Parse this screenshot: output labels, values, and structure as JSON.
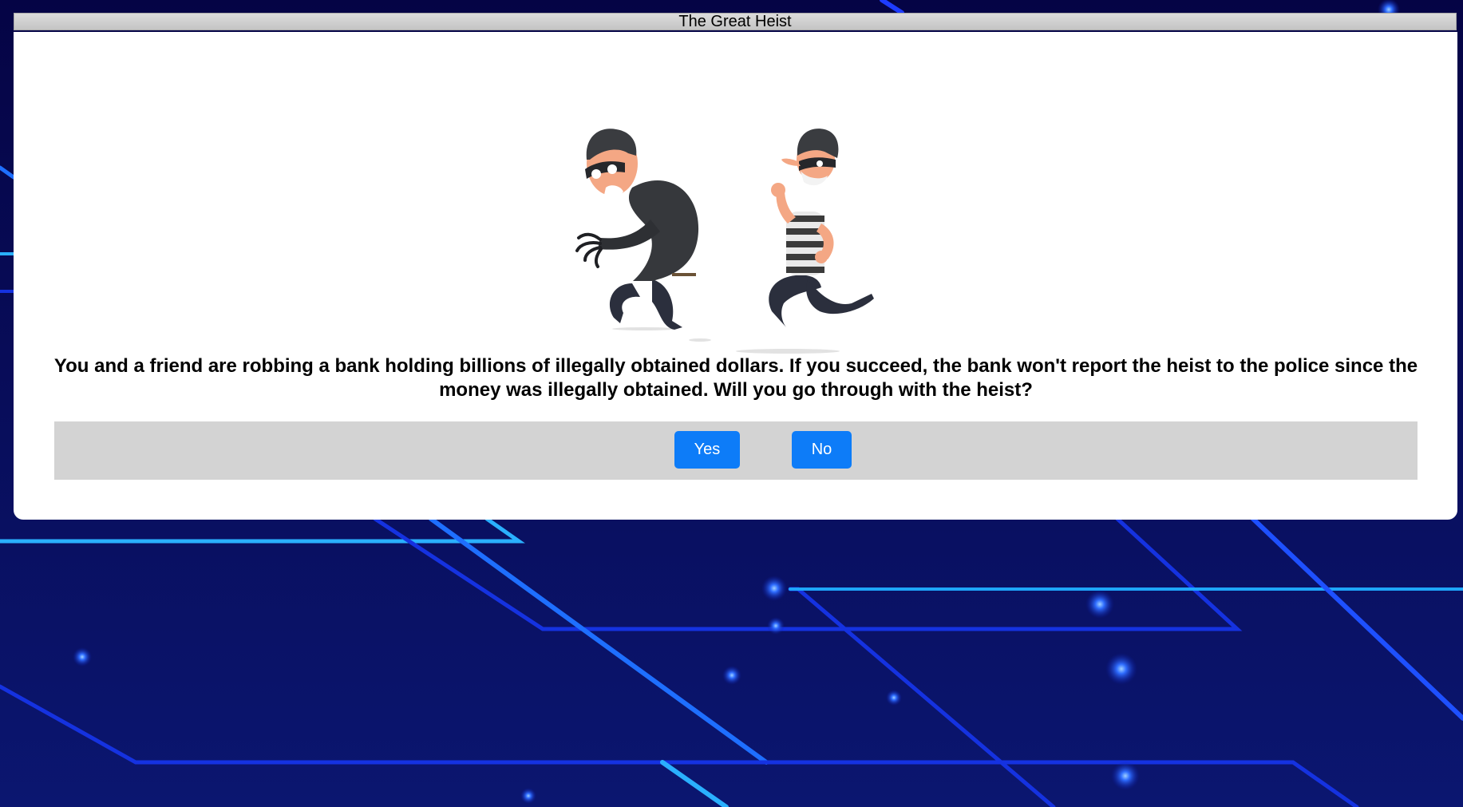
{
  "window": {
    "title": "The Great Heist"
  },
  "illustration": {
    "icon": "robbers-illustration"
  },
  "question": {
    "text": "You and a friend are robbing a bank holding billions of illegally obtained dollars. If you succeed, the bank won't report the heist to the police since the money was illegally obtained. Will you go through with the heist?"
  },
  "answers": {
    "yes_label": "Yes",
    "no_label": "No"
  },
  "colors": {
    "background": "#0a0a58",
    "button": "#0d7cf8",
    "answer_bar": "#d3d3d3"
  }
}
